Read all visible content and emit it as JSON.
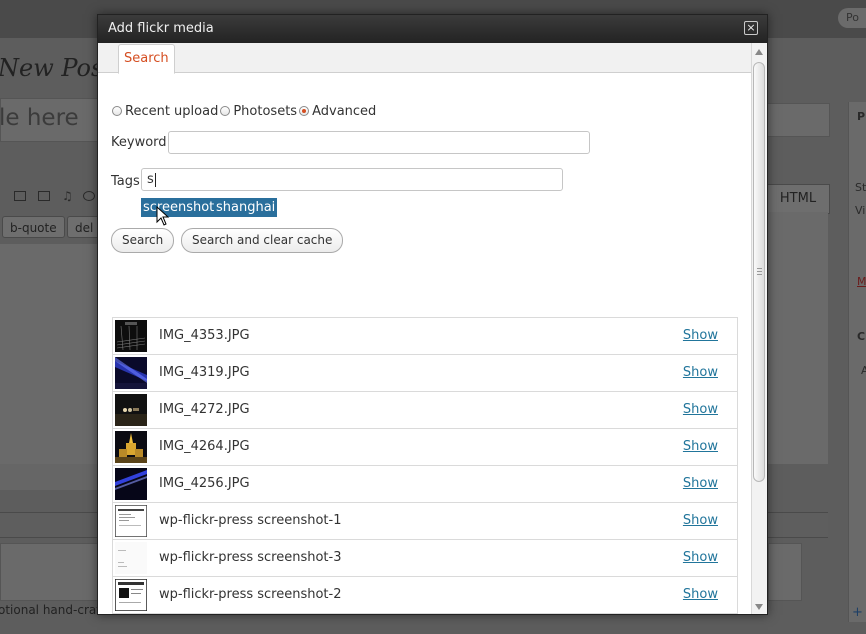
{
  "background": {
    "pill": "Po",
    "heading": "New Post",
    "title_placeholder": "le here",
    "quicktags": [
      "b-quote",
      "del"
    ],
    "html_tab": "HTML",
    "side_letters": [
      "P",
      "St",
      "Vi",
      "M",
      "C",
      "A"
    ],
    "bottom_text": "otional hand-craft",
    "plus": "+"
  },
  "dialog": {
    "title": "Add flickr media",
    "close_label": "×",
    "tabs": [
      {
        "label": "Search"
      }
    ],
    "search_mode": {
      "options": [
        "Recent upload",
        "Photosets",
        "Advanced"
      ],
      "selected": "Advanced"
    },
    "keyword": {
      "label": "Keyword:",
      "value": ""
    },
    "tags": {
      "label": "Tags:",
      "value": "s",
      "suggestions": [
        "screenshot",
        "shanghai"
      ]
    },
    "buttons": {
      "search": "Search",
      "search_clear": "Search and clear cache"
    },
    "results": [
      {
        "name": "IMG_4353.JPG",
        "action": "Show",
        "thumb": "night-lights"
      },
      {
        "name": "IMG_4319.JPG",
        "action": "Show",
        "thumb": "blue-laser"
      },
      {
        "name": "IMG_4272.JPG",
        "action": "Show",
        "thumb": "night-scene"
      },
      {
        "name": "IMG_4264.JPG",
        "action": "Show",
        "thumb": "golden-building"
      },
      {
        "name": "IMG_4256.JPG",
        "action": "Show",
        "thumb": "blue-laser-2"
      },
      {
        "name": "wp-flickr-press screenshot-1",
        "action": "Show",
        "thumb": "screenshot-doc"
      },
      {
        "name": "wp-flickr-press screenshot-3",
        "action": "Show",
        "thumb": "screenshot-blank"
      },
      {
        "name": "wp-flickr-press screenshot-2",
        "action": "Show",
        "thumb": "screenshot-dark"
      }
    ]
  },
  "colors": {
    "accent": "#d54e21",
    "link": "#21759b",
    "highlight": "#2a6f9c",
    "overlay": "#5d5d5d",
    "titlebar": "#2e2e2e"
  }
}
